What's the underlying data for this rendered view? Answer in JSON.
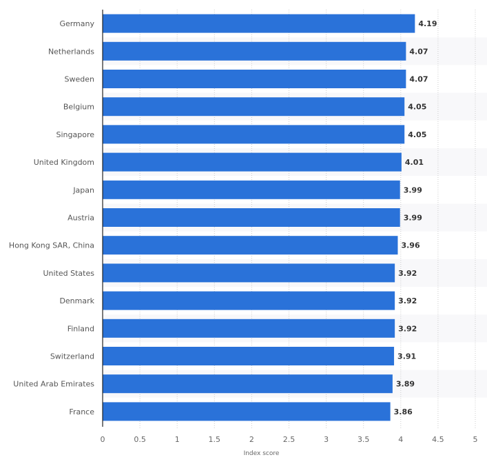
{
  "chart_data": {
    "type": "bar",
    "orientation": "horizontal",
    "title": "",
    "xlabel": "Index score",
    "ylabel": "",
    "xlim": [
      0,
      5
    ],
    "x_ticks": [
      "0",
      "0.5",
      "1",
      "1.5",
      "2",
      "2.5",
      "3",
      "3.5",
      "4",
      "4.5",
      "5"
    ],
    "grid": "vertical dotted",
    "legend": "none",
    "bar_color": "#2a72d9",
    "categories": [
      "Germany",
      "Netherlands",
      "Sweden",
      "Belgium",
      "Singapore",
      "United Kingdom",
      "Japan",
      "Austria",
      "Hong Kong SAR, China",
      "United States",
      "Denmark",
      "Finland",
      "Switzerland",
      "United Arab Emirates",
      "France"
    ],
    "values": [
      4.19,
      4.07,
      4.07,
      4.05,
      4.05,
      4.01,
      3.99,
      3.99,
      3.96,
      3.92,
      3.92,
      3.92,
      3.91,
      3.89,
      3.86
    ],
    "value_labels": [
      "4.19",
      "4.07",
      "4.07",
      "4.05",
      "4.05",
      "4.01",
      "3.99",
      "3.99",
      "3.96",
      "3.92",
      "3.92",
      "3.92",
      "3.91",
      "3.89",
      "3.86"
    ]
  }
}
